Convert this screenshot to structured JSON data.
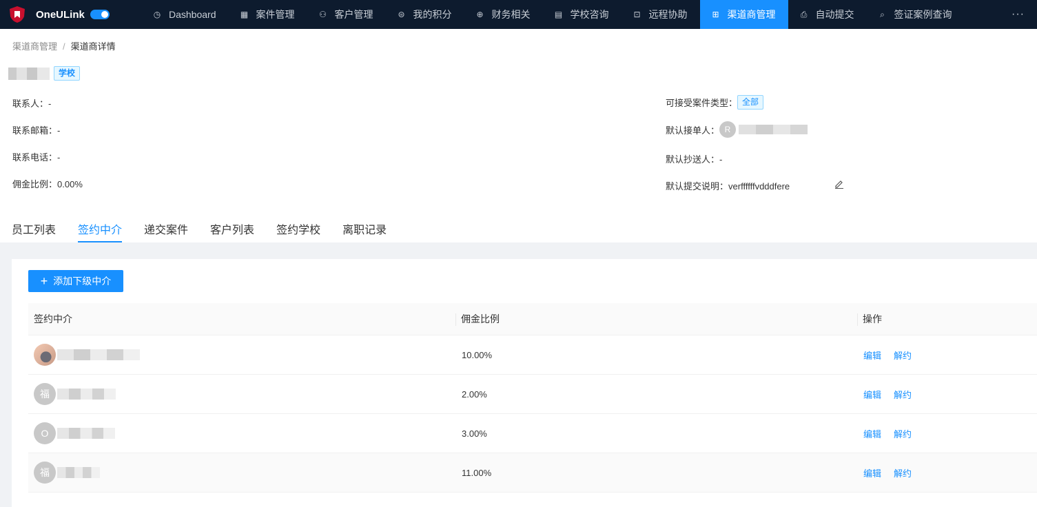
{
  "nav": {
    "brand": "OneULink",
    "items": [
      {
        "label": "Dashboard",
        "icon": "gauge-icon",
        "glyph": "◷"
      },
      {
        "label": "案件管理",
        "icon": "grid-icon",
        "glyph": "▦"
      },
      {
        "label": "客户管理",
        "icon": "users-icon",
        "glyph": "⚇"
      },
      {
        "label": "我的积分",
        "icon": "coin-icon",
        "glyph": "⊜"
      },
      {
        "label": "财务相关",
        "icon": "currency-icon",
        "glyph": "⊕"
      },
      {
        "label": "学校咨询",
        "icon": "book-icon",
        "glyph": "▤"
      },
      {
        "label": "远程协助",
        "icon": "screen-icon",
        "glyph": "⊡"
      },
      {
        "label": "渠道商管理",
        "icon": "hierarchy-icon",
        "glyph": "⊞",
        "active": true
      },
      {
        "label": "自动提交",
        "icon": "printer-icon",
        "glyph": "⎙"
      },
      {
        "label": "签证案例查询",
        "icon": "search-icon",
        "glyph": "⌕"
      }
    ],
    "more": "···",
    "accent": "#1890ff",
    "bg": "#0d1b2e"
  },
  "breadcrumb": {
    "parent": "渠道商管理",
    "sep": "/",
    "current": "渠道商详情"
  },
  "title": {
    "tag": "学校"
  },
  "info_left": {
    "contact": {
      "label": "联系人：",
      "value": "-"
    },
    "email": {
      "label": "联系邮箱：",
      "value": "-"
    },
    "phone": {
      "label": "联系电话：",
      "value": "-"
    },
    "commission": {
      "label": "佣金比例：",
      "value": "0.00%"
    }
  },
  "info_right": {
    "case_types": {
      "label": "可接受案件类型：",
      "tag": "全部"
    },
    "default_receiver": {
      "label": "默认接单人：",
      "avatar": "R"
    },
    "default_cc": {
      "label": "默认抄送人：",
      "value": "-"
    },
    "default_note": {
      "label": "默认提交说明：",
      "value": "verffffffvdddfere"
    }
  },
  "tabs": [
    "员工列表",
    "签约中介",
    "递交案件",
    "客户列表",
    "签约学校",
    "离职记录"
  ],
  "active_tab": 1,
  "add_button": {
    "plus": "+",
    "label": "添加下级中介"
  },
  "table": {
    "headers": [
      "签约中介",
      "佣金比例",
      "操作"
    ],
    "rows": [
      {
        "avatar": "",
        "photo": true,
        "rate": "10.00%",
        "actions": [
          "编辑",
          "解约"
        ]
      },
      {
        "avatar": "福",
        "photo": false,
        "rate": "2.00%",
        "actions": [
          "编辑",
          "解约"
        ]
      },
      {
        "avatar": "O",
        "photo": false,
        "rate": "3.00%",
        "actions": [
          "编辑",
          "解约"
        ]
      },
      {
        "avatar": "福",
        "photo": false,
        "rate": "11.00%",
        "actions": [
          "编辑",
          "解约"
        ]
      }
    ]
  }
}
